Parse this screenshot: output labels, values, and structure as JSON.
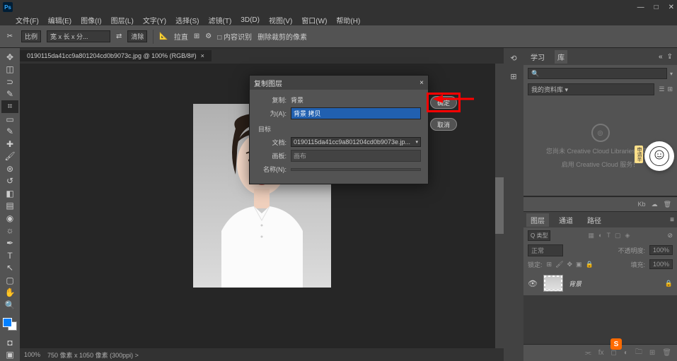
{
  "app": {
    "logo": "Ps"
  },
  "window_controls": {
    "min": "—",
    "max": "□",
    "close": "✕"
  },
  "menu": [
    "文件(F)",
    "编辑(E)",
    "图像(I)",
    "图层(L)",
    "文字(Y)",
    "选择(S)",
    "滤镜(T)",
    "3D(D)",
    "视图(V)",
    "窗口(W)",
    "帮助(H)"
  ],
  "options_bar": {
    "ratio_label": "比例",
    "w": "宽 x 长 x 分...",
    "clear": "清除",
    "straighten": "拉直",
    "content_aware": "□ 内容识别",
    "delete_cropped": "删除裁剪的像素"
  },
  "document": {
    "tab": "0190115da41cc9a801204cd0b9073c.jpg @ 100% (RGB/8#)",
    "tab_close": "×"
  },
  "status": {
    "zoom": "100%",
    "info": "750 像素 x 1050 像素 (300ppi)  >"
  },
  "dialog": {
    "title": "复制图层",
    "close": "×",
    "label_duplicate": "复制:",
    "value_duplicate": "背景",
    "label_as": "为(A):",
    "value_as": "背景 拷贝",
    "section_dest": "目标",
    "label_doc": "文档:",
    "value_doc": "0190115da41cc9a801204cd0b9073e.jp...",
    "label_artboard": "画板:",
    "value_artboard": "画布",
    "label_name": "名称(N):",
    "value_name": "",
    "btn_ok": "确定",
    "btn_cancel": "取消"
  },
  "libraries": {
    "tabs": [
      "学习",
      "库"
    ],
    "search_placeholder": "🔍",
    "dropdown": "我的资料库",
    "empty1": "您尚未 Creative Cloud Libraries。您应",
    "empty2": "启用 Creative Cloud 服务！",
    "kb": "Kb"
  },
  "layers": {
    "tabs": [
      "图层",
      "通道",
      "路径"
    ],
    "kind": "Q 类型",
    "mode": "正常",
    "opacity_label": "不透明度:",
    "opacity": "100%",
    "lock_label": "锁定:",
    "fill_label": "填充:",
    "fill": "100%",
    "item_name": "背景"
  },
  "sticker": {
    "text": "申请半"
  }
}
